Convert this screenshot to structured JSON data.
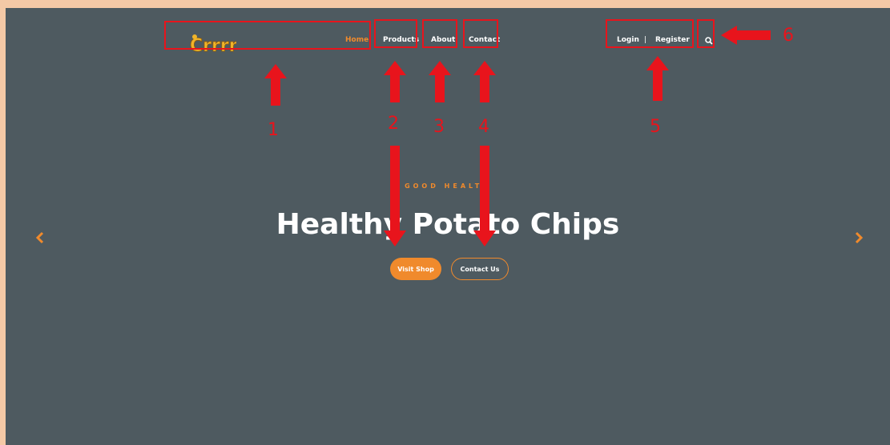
{
  "nav": {
    "logo_text": "Crrrn!",
    "items": [
      {
        "label": "Home",
        "active": true
      },
      {
        "label": "Products"
      },
      {
        "label": "About"
      },
      {
        "label": "Contact"
      }
    ],
    "login": "Login",
    "separator": "|",
    "register": "Register"
  },
  "hero": {
    "eyebrow": "GOOD HEALTH",
    "title": "Healthy Potato Chips",
    "btn_shop": "Visit Shop",
    "btn_contact": "Contact Us"
  },
  "annotations": [
    "1",
    "2",
    "3",
    "4",
    "5",
    "6"
  ],
  "colors": {
    "background": "#4e5a60",
    "accent": "#f08a2c",
    "annotation": "#e8141c",
    "border": "#f4c9a6"
  }
}
